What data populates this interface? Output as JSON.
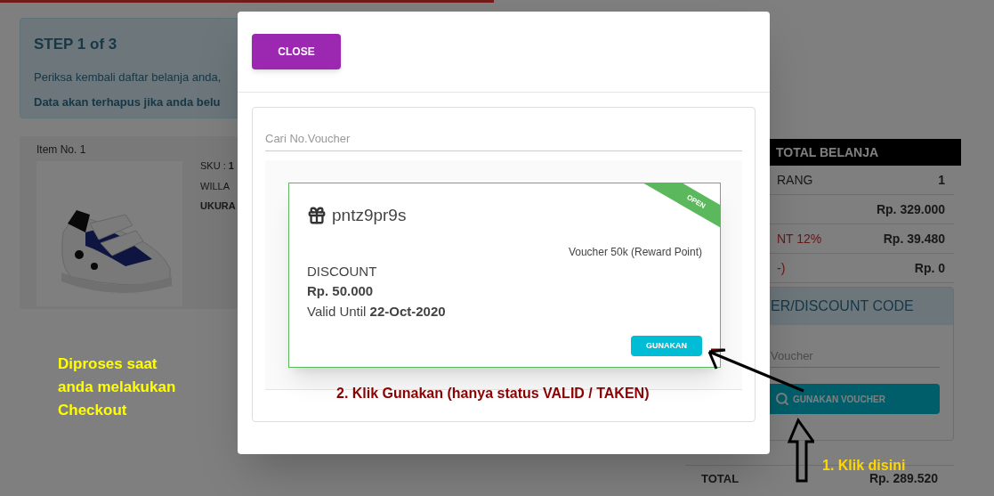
{
  "page": {
    "step_title": "STEP 1 of 3",
    "info_text": "Periksa kembali daftar belanja anda,",
    "warning_text": "Data akan terhapus jika anda belu",
    "item": {
      "label": "Item No. 1",
      "sku_label": "SKU :",
      "sku_value": "1",
      "name": "WILLA",
      "size_label": "UKURA"
    },
    "note": "Diproses saat anda melakukan Checkout"
  },
  "summary": {
    "title": "TOTAL BELANJA",
    "rows": [
      {
        "label": "RANG",
        "value": "1",
        "kind": "normal"
      },
      {
        "value": "Rp. 329.000"
      },
      {
        "label": "NT 12%",
        "value": "Rp. 39.480",
        "kind": "deduction"
      },
      {
        "label": "-)",
        "value": "Rp. 0",
        "kind": "deduction"
      }
    ],
    "voucher_panel": {
      "title": "ER/DISCOUNT CODE",
      "placeholder": "Voucher",
      "button": "GUNAKAN VOUCHER"
    },
    "total": {
      "label": "TOTAL",
      "value": "Rp. 289.520"
    }
  },
  "modal": {
    "close": "CLOSE",
    "search_placeholder": "Cari No.Voucher",
    "vouchers": [
      {
        "code": "pntz9pr9s",
        "status": "OPEN",
        "description": "Voucher 50k (Reward Point)",
        "type": "DISCOUNT",
        "amount": "Rp. 50.000",
        "valid_label": "Valid Until",
        "valid_date": "22-Oct-2020",
        "button": "GUNAKAN"
      }
    ]
  },
  "annotations": {
    "step2": "2. Klik Gunakan (hanya status VALID / TAKEN)",
    "step1": "1. Klik disini"
  }
}
